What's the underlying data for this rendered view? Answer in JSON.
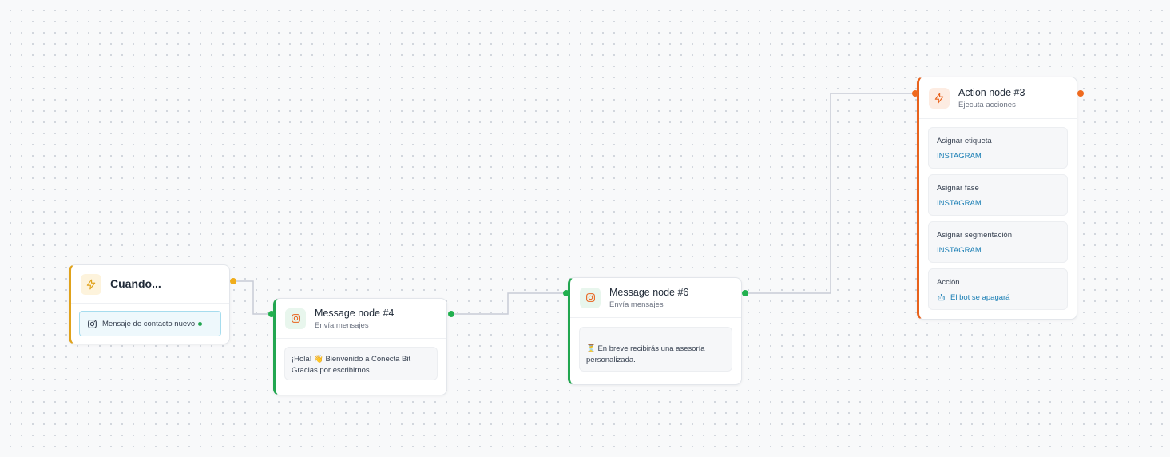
{
  "colors": {
    "trigger": "#e0a21b",
    "message": "#22a650",
    "action": "#e8621c",
    "edge": "#c8ccd6",
    "link": "#1b7fb5"
  },
  "trigger": {
    "icon": "lightning-icon",
    "title": "Cuando...",
    "condition_icon": "instagram-icon",
    "condition": "Mensaje de contacto nuevo"
  },
  "message4": {
    "icon": "instagram-icon",
    "title": "Message node #4",
    "subtitle": "Envía mensajes",
    "line1": "¡Hola! 👋 Bienvenido a Conecta Bit",
    "line2": "Gracias por escribirnos"
  },
  "message6": {
    "icon": "instagram-icon",
    "title": "Message node #6",
    "subtitle": "Envía mensajes",
    "text": "⏳ En breve recibirás una asesoría personalizada."
  },
  "action3": {
    "icon": "lightning-icon",
    "title": "Action node #3",
    "subtitle": "Ejecuta acciones",
    "items": [
      {
        "label": "Asignar etiqueta",
        "value": "INSTAGRAM"
      },
      {
        "label": "Asignar fase",
        "value": "INSTAGRAM"
      },
      {
        "label": "Asignar segmentación",
        "value": "INSTAGRAM"
      },
      {
        "label": "Acción",
        "value": "El bot se apagará",
        "value_icon": "robot-icon"
      }
    ]
  }
}
